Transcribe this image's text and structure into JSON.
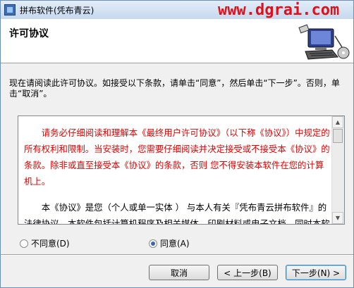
{
  "window": {
    "title": "拼布软件(凭布青云)"
  },
  "watermark": "www.dgrai.com",
  "header": {
    "title": "许可协议"
  },
  "intro": "现在请阅读此许可协议。如接受以下条款，请单击“同意”，然后单击“下一步”。否则，单击“取消”。",
  "license": {
    "para1": "请务必仔细阅读和理解本《最终用户许可协议》（以下称《协议》）中规定的所有权利和限制。当安装时，您需要仔细阅读并决定接受或不接受本《协议》的条款。除非或直至接受本《协议》的条款，否则 您不得安装本软件在您的计算机上。",
    "para2": "本《协议》是您（个人或单一实体 ） 与本人有关『凭布青云拼布软件』的法律协议。本软件包括计算机程序及相关媒体、印刷材料或电子文档。同时本软件还包括本人提供给您的原『凭布青云拼布软件』的任何更新和补充资料。您一旦安装"
  },
  "options": {
    "disagree": "不同意(D)",
    "agree": "同意(A)",
    "selected": "agree"
  },
  "buttons": {
    "cancel": "取消",
    "back": "< 上一步(B)",
    "next": "下一步(N) >"
  },
  "colors": {
    "license_text_red": "#e00000",
    "titlebar": "#c6d8ee",
    "watermark": "#e0101a"
  }
}
